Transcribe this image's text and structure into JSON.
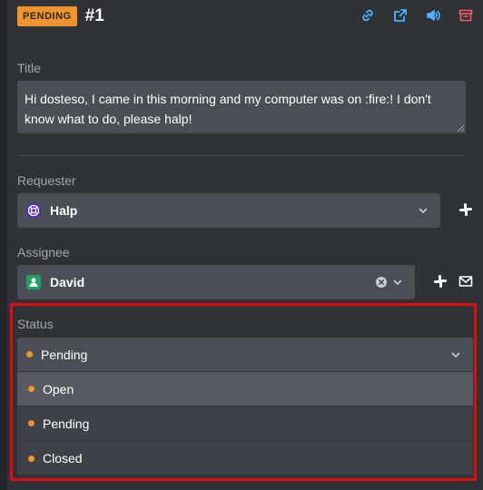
{
  "header": {
    "badge": "PENDING",
    "ticket_id": "#1",
    "icons": [
      "link-icon",
      "external-link-icon",
      "speaker-icon",
      "archive-icon"
    ]
  },
  "title_field": {
    "label": "Title",
    "value": "Hi dosteso, I came in this morning and my computer was on :fire:! I don't know what to do, please halp!"
  },
  "requester": {
    "label": "Requester",
    "value": "Halp"
  },
  "assignee": {
    "label": "Assignee",
    "value": "David"
  },
  "status": {
    "label": "Status",
    "selected": "Pending",
    "options": [
      "Open",
      "Pending",
      "Closed"
    ]
  },
  "colors": {
    "accent": "#f0932b",
    "highlight": "#e20b0b",
    "field_bg": "#4a4e55"
  }
}
